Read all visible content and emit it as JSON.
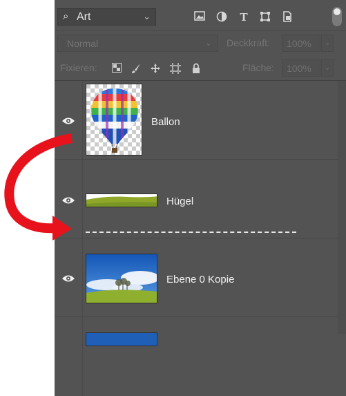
{
  "toolbar": {
    "filter_label": "Art",
    "filter_icons": [
      "image-filter-icon",
      "adjustment-filter-icon",
      "type-filter-icon",
      "shape-filter-icon",
      "smart-object-filter-icon"
    ]
  },
  "blend": {
    "mode": "Normal",
    "opacity_label": "Deckkraft:",
    "opacity_value": "100%"
  },
  "lock": {
    "label": "Fixieren:",
    "fill_label": "Fläche:",
    "fill_value": "100%"
  },
  "layers": [
    {
      "name": "Ballon",
      "visible": true
    },
    {
      "name": "Hügel",
      "visible": true
    },
    {
      "name": "Ebene 0 Kopie",
      "visible": true
    }
  ],
  "colors": {
    "panel": "#535353",
    "arrow": "#e8121c",
    "text": "#f0f0f0"
  }
}
